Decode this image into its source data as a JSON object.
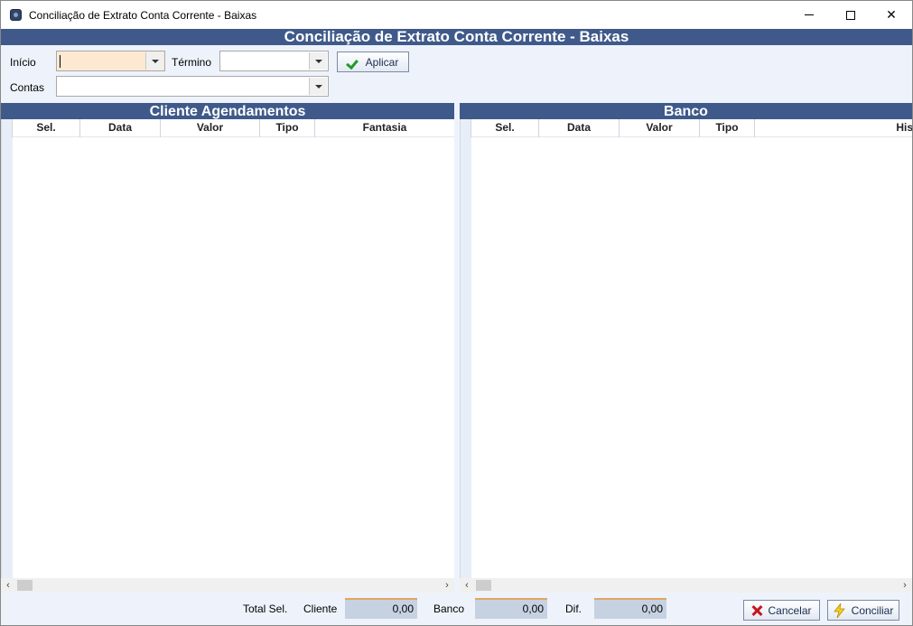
{
  "window": {
    "title": "Conciliação de Extrato Conta Corrente - Baixas"
  },
  "header": {
    "title": "Conciliação de Extrato Conta Corrente - Baixas"
  },
  "filters": {
    "inicio_label": "Início",
    "termino_label": "Término",
    "contas_label": "Contas",
    "inicio_value": "",
    "termino_value": "",
    "contas_value": "",
    "aplicar_label": "Aplicar"
  },
  "cliente": {
    "title": "Cliente Agendamentos",
    "columns": [
      "Sel.",
      "Data",
      "Valor",
      "Tipo",
      "Fantasia"
    ]
  },
  "banco": {
    "title": "Banco",
    "columns": [
      "Sel.",
      "Data",
      "Valor",
      "Tipo",
      "His"
    ]
  },
  "footer": {
    "total_label": "Total Sel.",
    "cliente_label": "Cliente",
    "cliente_value": "0,00",
    "banco_label": "Banco",
    "banco_value": "0,00",
    "dif_label": "Dif.",
    "dif_value": "0,00",
    "cancelar_label": "Cancelar",
    "conciliar_label": "Conciliar"
  },
  "icons": {
    "aplicar": "check-icon",
    "cancelar": "x-icon",
    "conciliar": "lightning-icon"
  },
  "colors": {
    "header_band": "#3f5a8a",
    "panel_bg": "#eef3fb",
    "highlight_field": "#fde9d2",
    "total_box": "#c6d2e2"
  }
}
